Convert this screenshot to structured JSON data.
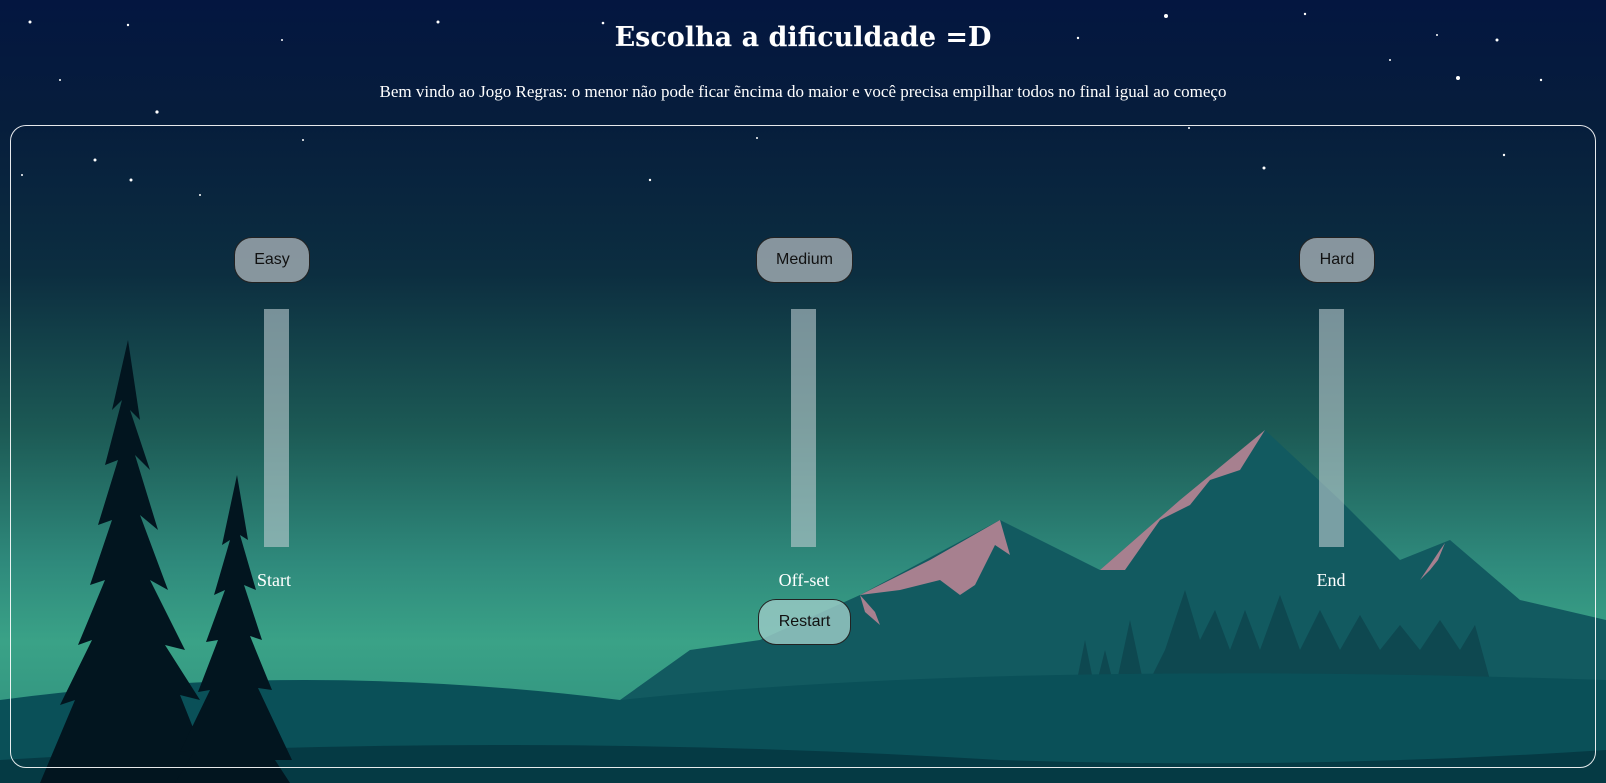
{
  "header": {
    "title": "Escolha a dificuldade =D",
    "subtitle": "Bem vindo ao Jogo Regras: o menor não pode ficar ẽncima do maior e você precisa empilhar todos no final igual ao começo"
  },
  "difficulty": {
    "easy_label": "Easy",
    "medium_label": "Medium",
    "hard_label": "Hard"
  },
  "towers": {
    "start_label": "Start",
    "offset_label": "Off-set",
    "end_label": "End"
  },
  "controls": {
    "restart_label": "Restart"
  },
  "colors": {
    "sky_top": "#041640",
    "sky_mid": "#1c5a55",
    "ground": "#3aa287",
    "mountain": "#125a60",
    "peak_snow": "#a7808f",
    "tree": "#02151f",
    "tower": "#bccdd2"
  }
}
